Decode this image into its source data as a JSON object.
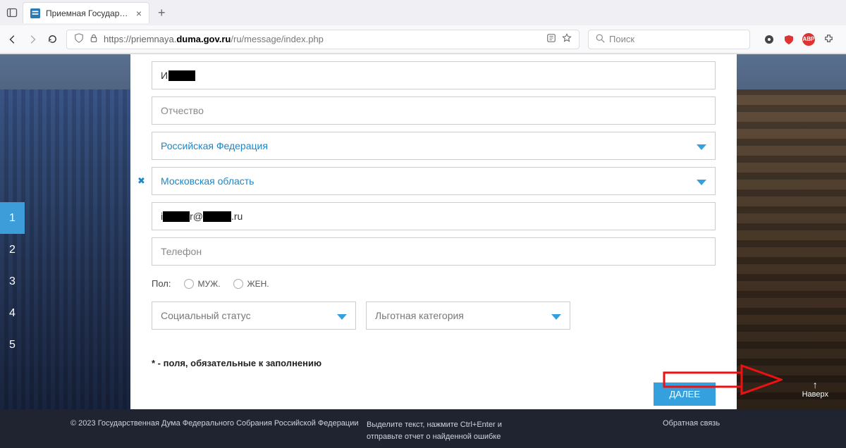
{
  "browser": {
    "tab_title": "Приемная Государственной Д",
    "url_pre": "https://priemnaya.",
    "url_host": "duma.gov.ru",
    "url_path": "/ru/message/index.php",
    "search_placeholder": "Поиск",
    "abp_label": "ABP"
  },
  "steps": [
    "1",
    "2",
    "3",
    "4",
    "5"
  ],
  "form": {
    "name_prefix": "И",
    "patronymic_ph": "Отчество",
    "country": "Российская Федерация",
    "region": "Московская область",
    "email_prefix": "i",
    "email_mid": "r@",
    "email_suffix": ".ru",
    "phone_ph": "Телефон",
    "gender_label": "Пол:",
    "gender_m": "МУЖ.",
    "gender_f": "ЖЕН.",
    "social_ph": "Социальный статус",
    "benefit_ph": "Льготная категория",
    "required_note": "* - поля, обязательные к заполнению",
    "next_btn": "ДАЛЕЕ"
  },
  "totop": "Наверх",
  "footer": {
    "copyright": "© 2023 Государственная Дума Федерального Собрания Российской Федерации",
    "hint1": "Выделите текст, нажмите Ctrl+Enter и",
    "hint2": "отправьте отчет о найденной ошибке",
    "feedback": "Обратная связь"
  }
}
